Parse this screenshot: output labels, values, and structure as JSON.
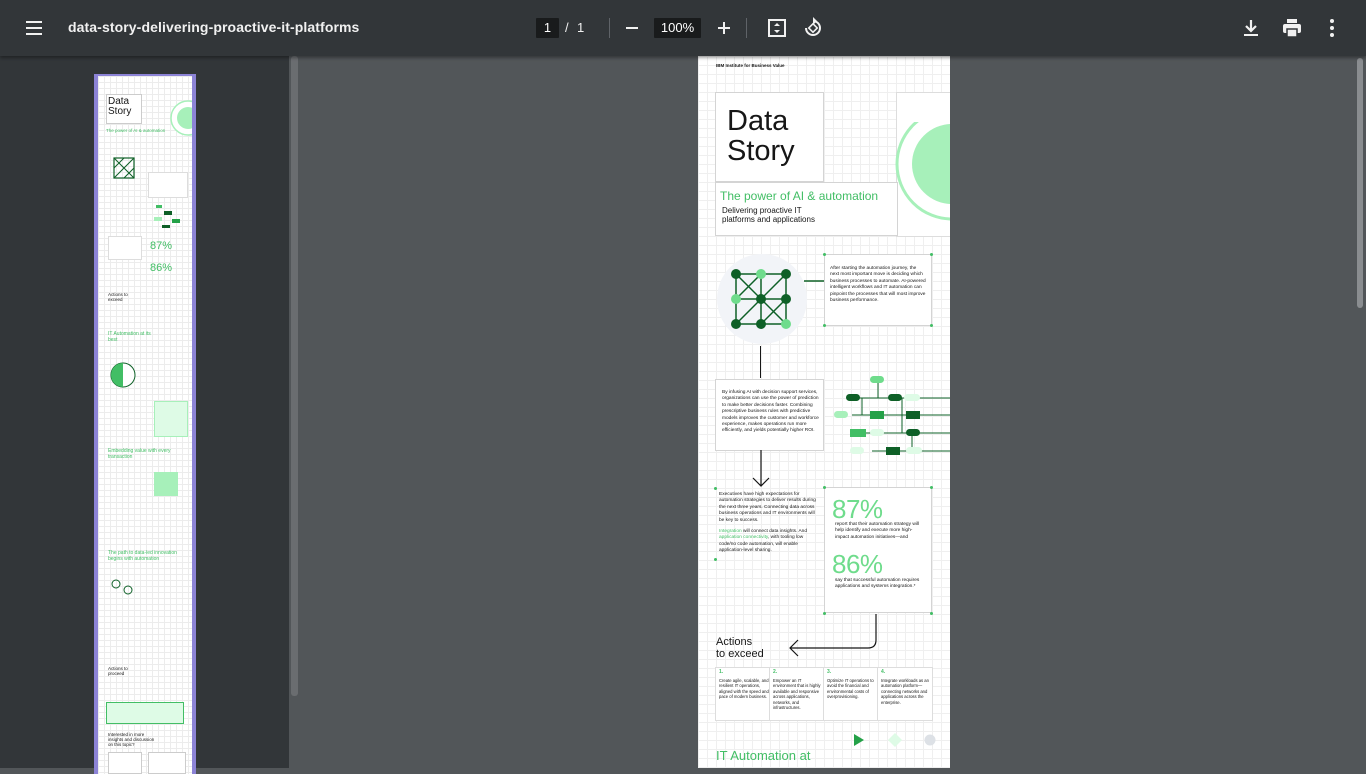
{
  "toolbar": {
    "title": "data-story-delivering-proactive-it-platforms",
    "current_page": "1",
    "page_separator": "/",
    "total_pages": "1",
    "zoom": "100%",
    "icons": [
      "menu-icon",
      "zoom-out-icon",
      "zoom-in-icon",
      "fit-page-icon",
      "rotate-icon",
      "download-icon",
      "print-icon",
      "more-icon"
    ]
  },
  "document": {
    "header": "IBM Institute for Business Value",
    "title_line1": "Data",
    "title_line2": "Story",
    "subtitle": "The power of AI & automation",
    "tagline_line1": "Delivering proactive IT",
    "tagline_line2": "platforms and applications",
    "block1": "After starting the automation journey, the next most important move is deciding which business processes to automate. AI-powered intelligent workflows and IT automation can pinpoint the processes that will most improve business performance.",
    "block2": "By infusing AI with decision support services, organizations can use the power of prediction to make better decisions faster. Combining prescriptive business rules with predictive models improves the customer and workforce experience, makes operations run more efficiently, and yields potentially higher ROI.",
    "block3": "Executives have high expectations for automation strategies to deliver results during the next three years. Connecting data across business operations and IT environments will be key to success.",
    "block3b_pre": "Integration",
    "block3b_mid": " will connect data insights. And ",
    "block3b_link": "application connectivity",
    "block3b_post": ", with tooling low code/no code automation, will enable application-level sharing.",
    "stat1_value": "87%",
    "stat1_text": "report that their automation strategy will help identify and execute more high-impact automation initiatives—and",
    "stat2_value": "86%",
    "stat2_text": "say that successful automation requires applications and systems integration.*",
    "actions_line1": "Actions",
    "actions_line2": "to exceed",
    "steps": [
      {
        "n": "1.",
        "text": "Create agile, scalable, and resilient IT operations, aligned with the speed and pace of modern business."
      },
      {
        "n": "2.",
        "text": "Empower an IT environment that is highly available and responsive across applications, networks, and infrastructures."
      },
      {
        "n": "3.",
        "text": "Optimize IT operations to avoid the financial and environmental costs of overprovisioning."
      },
      {
        "n": "4.",
        "text": "Integrate workloads as an automation platform—connecting networks and applications across the enterprise."
      }
    ],
    "section_title": "IT Automation at"
  },
  "thumbnail": {
    "labels": [
      "Data",
      "Story",
      "The power of AI & automation",
      "87%",
      "86%",
      "Actions to exceed",
      "IT Automation at its best",
      "Embedding value with every transaction",
      "The path to data-led innovation begins with automation",
      "Actions to proceed",
      "Interested in more insights and discussion on this topic?"
    ]
  },
  "colors": {
    "accent": "#42be65",
    "light_accent": "#a7f0ba",
    "dark_green": "#0e6027",
    "toolbar": "#323639",
    "viewer_bg": "#525659",
    "thumb_border": "#8c83d6"
  }
}
